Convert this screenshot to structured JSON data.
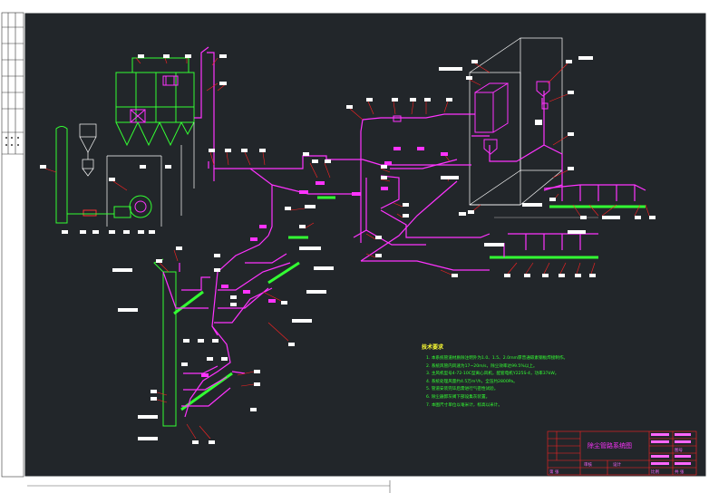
{
  "drawing": {
    "colors": {
      "background": "#22262a",
      "frame": "#ffffff",
      "duct": "#ff33ff",
      "equipment": "#33ff33",
      "leader": "#ff2222",
      "dimension": "#ffffff",
      "notes_title": "#ffff33",
      "notes_text": "#33ff33"
    }
  },
  "notes": {
    "title": "技术要求",
    "items": [
      "1. 本系统管道材质除注明外为1.0、1.5、2.0mm厚普通碳素钢板焊接制作。",
      "2. 系统风管内风速为17~20m/s，除尘效率达99.5%以上。",
      "3. 主风机型号4-72-10C型离心风机，配套电机Y225S-4，功率37kW。",
      "4. 系统处理风量约4.5万m³/h，全压约2800Pa。",
      "5. 管道安装完毕后需进行气密性试验。",
      "6. 除尘器卸灰阀下部设集灰装置。",
      "7. 本图尺寸单位以毫米计，标高以米计。"
    ]
  },
  "title_block": {
    "drawing_name": "除尘管路系统图",
    "cells": [
      "审核",
      "设计",
      "比例",
      "图号",
      "共 张",
      "第 张"
    ]
  }
}
